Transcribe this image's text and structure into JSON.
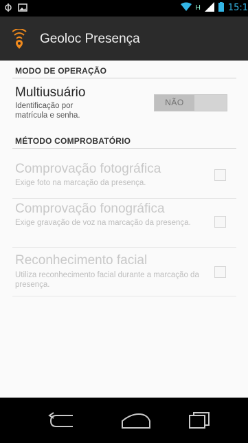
{
  "status_bar": {
    "time": "15:1",
    "network_label": "H"
  },
  "action_bar": {
    "title": "Geoloc Presença",
    "icon": "location-signal-icon"
  },
  "sections": {
    "mode_header": "MODO DE OPERAÇÃO",
    "method_header": "MÉTODO COMPROBATÓRIO"
  },
  "multiuser": {
    "title": "Multiusuário",
    "summary": "Identificação por matrícula e senha.",
    "toggle_label": "NÃO"
  },
  "prefs": [
    {
      "title": "Comprovação fotográfica",
      "summary": "Exige foto na marcação da presença.",
      "checked": false
    },
    {
      "title": "Comprovação fonográfica",
      "summary": "Exige gravação de voz na marcação da presença.",
      "checked": false
    },
    {
      "title": "Reconhecimento facial",
      "summary": "Utiliza reconhecimento facial durante a marcação da presença.",
      "checked": false
    }
  ],
  "navigation": {
    "back": "back-icon",
    "home": "home-icon",
    "recents": "recents-icon"
  },
  "colors": {
    "accent": "#33b5e5",
    "app_icon": "#f08a1d"
  }
}
